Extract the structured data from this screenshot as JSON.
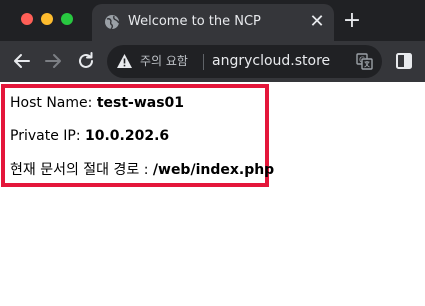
{
  "browser": {
    "tab": {
      "title": "Welcome to the NCP",
      "close_label": "✕"
    },
    "new_tab_label": "+",
    "address_bar": {
      "security_warning": "주의 요함",
      "url": "angrycloud.store"
    }
  },
  "page": {
    "host_name": {
      "label": "Host Name:",
      "value": "test-was01"
    },
    "private_ip": {
      "label": "Private IP:",
      "value": "10.0.202.6"
    },
    "doc_path": {
      "label": "현재 문서의 절대 경로 :",
      "value": "/web/index.php"
    }
  },
  "colors": {
    "highlight_border": "#e4163a",
    "chrome_dark": "#202124",
    "toolbar": "#35363a"
  },
  "icons": [
    "globe-icon",
    "close-icon",
    "plus-icon",
    "back-arrow-icon",
    "forward-arrow-icon",
    "reload-icon",
    "warning-icon",
    "translate-icon",
    "side-panel-icon"
  ]
}
